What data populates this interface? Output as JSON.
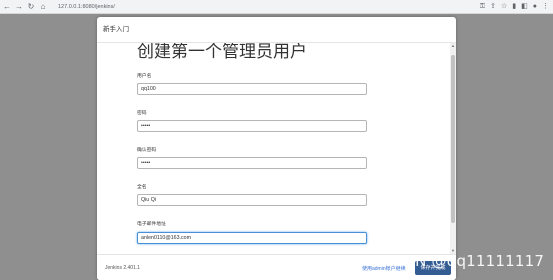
{
  "browser": {
    "url": "127.0.0.1:8080/jenkins/",
    "back_icon": "arrow-left-icon",
    "forward_icon": "arrow-right-icon",
    "reload_icon": "reload-icon"
  },
  "modal": {
    "header": "新手入门",
    "title": "创建第一个管理员用户",
    "fields": [
      {
        "label": "用户名",
        "value": "qq100"
      },
      {
        "label": "密码",
        "value": "•••••"
      },
      {
        "label": "确认密码",
        "value": "•••••"
      },
      {
        "label": "全名",
        "value": "Qiu Qi"
      },
      {
        "label": "电子邮件地址",
        "value": "anlen0110@163.com"
      }
    ],
    "footer": {
      "version": "Jenkins 2.401.1",
      "skip_link": "使用admin账户继续",
      "save_button": "保存并完成"
    }
  },
  "watermark": "CSDN @qq11111117"
}
